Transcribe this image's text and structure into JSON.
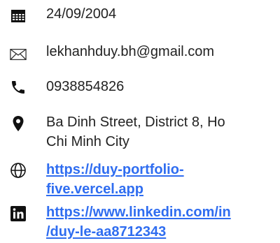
{
  "contact": {
    "items": [
      {
        "icon": "calendar-icon",
        "text": "24/09/2004"
      },
      {
        "icon": "envelope-icon",
        "text": "lekhanhduy.bh@gmail.com"
      },
      {
        "icon": "phone-icon",
        "text": "0938854826"
      },
      {
        "icon": "location-pin-icon",
        "line1": "Ba Dinh Street, District 8, Ho",
        "line2": "Chi Minh City"
      },
      {
        "icon": "globe-icon",
        "line1": "https://duy-portfolio-",
        "line2": "five.vercel.app"
      },
      {
        "icon": "linkedin-icon",
        "line1": "https://www.linkedin.com/in",
        "line2": "/duy-le-aa8712343"
      }
    ],
    "colors": {
      "text": "#222222",
      "link": "#2f6df0",
      "icon": "#111111"
    }
  }
}
